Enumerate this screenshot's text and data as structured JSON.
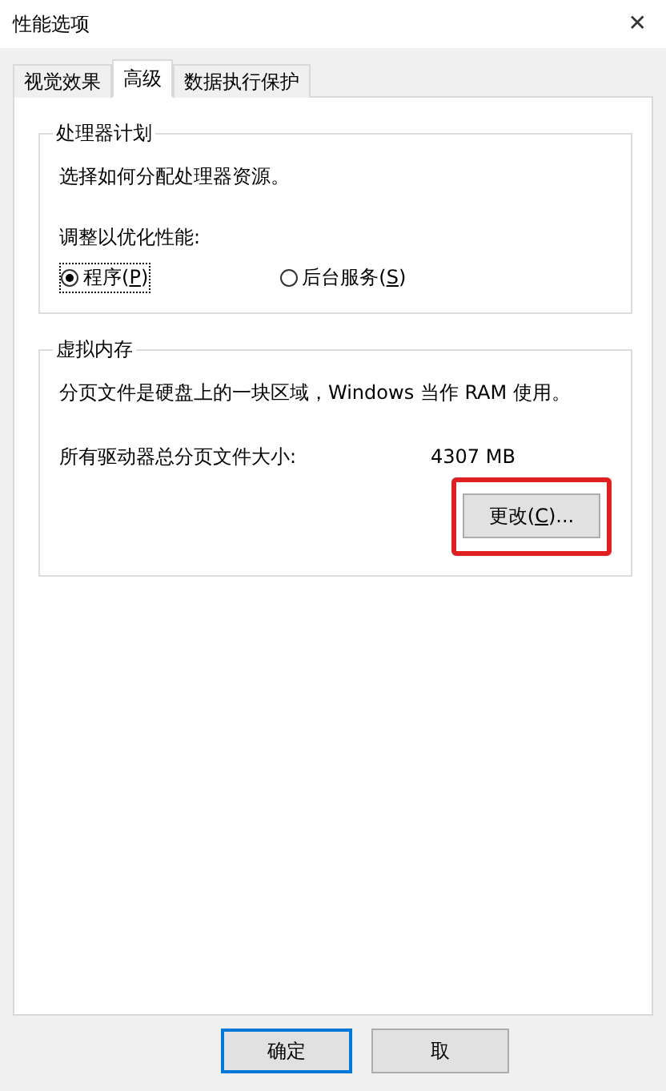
{
  "window": {
    "title": "性能选项",
    "close": "✕"
  },
  "tabs": [
    {
      "label": "视觉效果",
      "selected": false
    },
    {
      "label": "高级",
      "selected": true
    },
    {
      "label": "数据执行保护",
      "selected": false
    }
  ],
  "processor": {
    "title": "处理器计划",
    "description": "选择如何分配处理器资源。",
    "prompt": "调整以优化性能:",
    "options": [
      {
        "label": "程序(",
        "key": "P",
        "suffix": ")",
        "selected": true
      },
      {
        "label": "后台服务(",
        "key": "S",
        "suffix": ")",
        "selected": false
      }
    ]
  },
  "virtual_memory": {
    "title": "虚拟内存",
    "description": "分页文件是硬盘上的一块区域，Windows 当作 RAM 使用。",
    "size_label": "所有驱动器总分页文件大小:",
    "size_value": "4307 MB",
    "change_button": {
      "label": "更改(",
      "key": "C",
      "suffix": ")...",
      "highlighted": true
    }
  },
  "buttons": [
    {
      "label": "确定",
      "default": true
    },
    {
      "label": "取",
      "default": false
    }
  ]
}
